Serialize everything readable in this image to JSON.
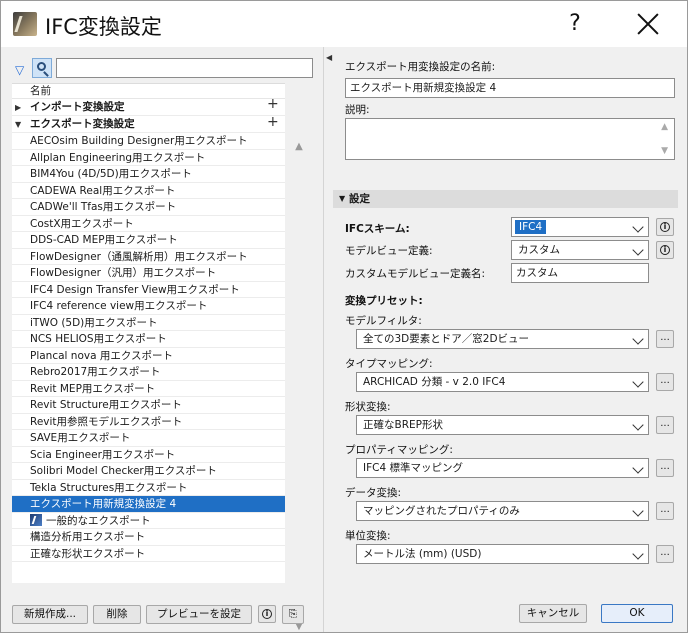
{
  "window": {
    "title": "IFC変換設定",
    "help_label": "?"
  },
  "left": {
    "search_value": "",
    "list_header": "名前",
    "groups": [
      {
        "label": "インポート変換設定",
        "expanded": false
      },
      {
        "label": "エクスポート変換設定",
        "expanded": true
      }
    ],
    "items": [
      "AECOsim Building Designer用エクスポート",
      "Allplan Engineering用エクスポート",
      "BIM4You (4D/5D)用エクスポート",
      "CADEWA Real用エクスポート",
      "CADWe'll Tfas用エクスポート",
      "CostX用エクスポート",
      "DDS-CAD MEP用エクスポート",
      "FlowDesigner（通風解析用）用エクスポート",
      "FlowDesigner（汎用）用エクスポート",
      "IFC4 Design Transfer View用エクスポート",
      "IFC4 reference view用エクスポート",
      "iTWO (5D)用エクスポート",
      "NCS HELIOS用エクスポート",
      "Plancal nova 用エクスポート",
      "Rebro2017用エクスポート",
      "Revit MEP用エクスポート",
      "Revit Structure用エクスポート",
      "Revit用参照モデルエクスポート",
      "SAVE用エクスポート",
      "Scia Engineer用エクスポート",
      "Solibri Model Checker用エクスポート",
      "Tekla Structures用エクスポート",
      "エクスポート用新規変換設定 4",
      "一般的なエクスポート",
      "構造分析用エクスポート",
      "正確な形状エクスポート"
    ],
    "selected_index": 22,
    "icon_item_index": 23,
    "buttons": {
      "new": "新規作成...",
      "delete": "削除",
      "preview": "プレビューを設定"
    }
  },
  "right": {
    "name_label": "エクスポート用変換設定の名前:",
    "name_value": "エクスポート用新規変換設定 4",
    "desc_label": "説明:",
    "desc_value": "",
    "section_label": "設定",
    "ifc_scheme_label": "IFCスキーム:",
    "ifc_scheme_value": "IFC4",
    "model_view_label": "モデルビュー定義:",
    "model_view_value": "カスタム",
    "custom_mvd_label": "カスタムモデルビュー定義名:",
    "custom_mvd_value": "カスタム",
    "preset_label": "変換プリセット:",
    "presets": [
      {
        "label": "モデルフィルタ:",
        "value": "全ての3D要素とドア／窓2Dビュー"
      },
      {
        "label": "タイプマッピング:",
        "value": "ARCHICAD 分類 - v 2.0 IFC4"
      },
      {
        "label": "形状変換:",
        "value": "正確なBREP形状"
      },
      {
        "label": "プロパティマッピング:",
        "value": "IFC4 標準マッピング"
      },
      {
        "label": "データ変換:",
        "value": "マッピングされたプロパティのみ"
      },
      {
        "label": "単位変換:",
        "value": "メートル法 (mm) (USD)"
      }
    ],
    "dots_label": "...",
    "cancel": "キャンセル",
    "ok": "OK"
  }
}
